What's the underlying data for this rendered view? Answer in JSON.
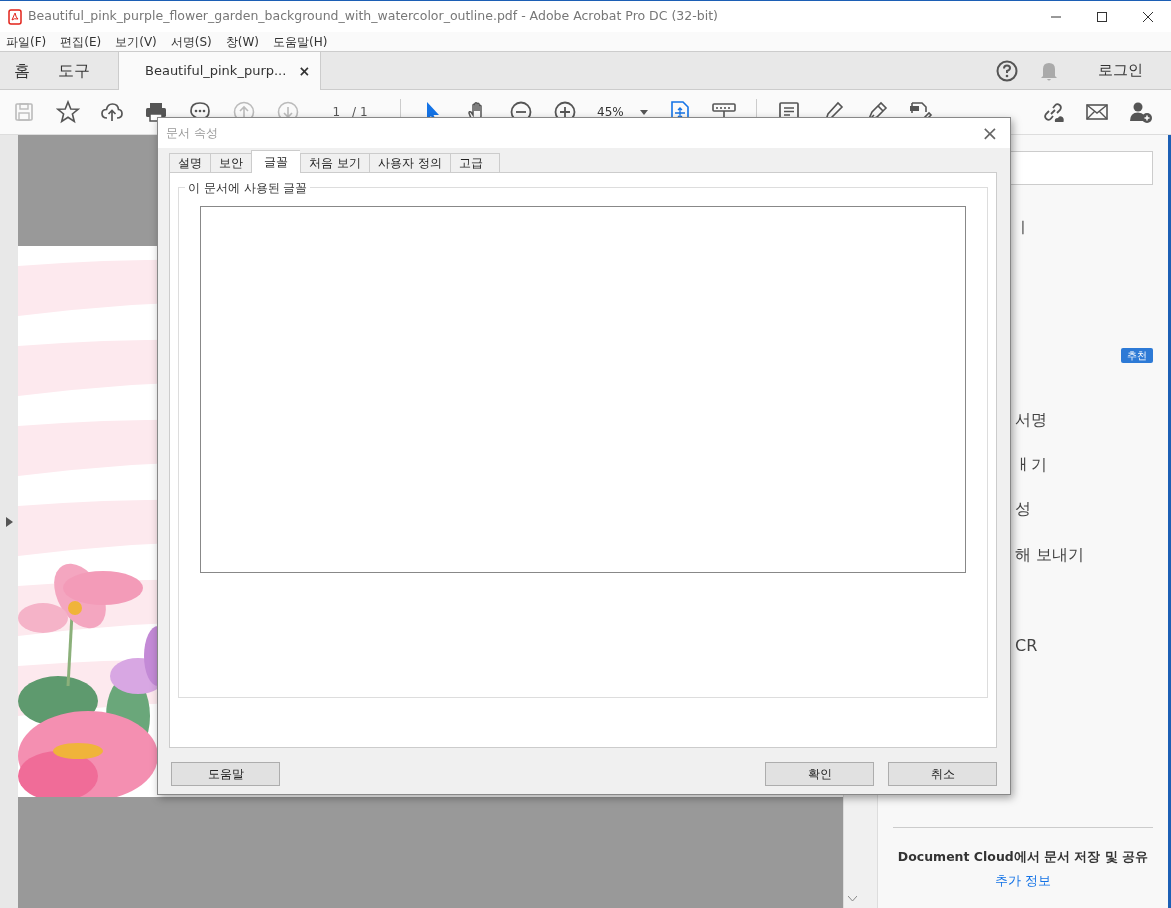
{
  "window": {
    "title": "Beautiful_pink_purple_flower_garden_background_with_watercolor_outline.pdf - Adobe Acrobat Pro DC (32-bit)"
  },
  "menu": [
    "파일(F)",
    "편집(E)",
    "보기(V)",
    "서명(S)",
    "창(W)",
    "도움말(H)"
  ],
  "app_tabs": [
    {
      "label": "홈",
      "selected": false
    },
    {
      "label": "도구",
      "selected": false
    },
    {
      "label": "Beautiful_pink_purp...",
      "selected": true,
      "close": "×"
    }
  ],
  "login": "로그인",
  "toolbar": {
    "items": [
      {
        "kind": "save",
        "disabled": true
      },
      {
        "kind": "star",
        "disabled": false
      },
      {
        "kind": "upload",
        "disabled": false
      },
      {
        "kind": "print",
        "disabled": false
      },
      {
        "kind": "more",
        "disabled": false
      },
      {
        "kind": "up",
        "disabled": true
      },
      {
        "kind": "down",
        "disabled": true
      }
    ],
    "page": "1",
    "page_total": "/ 1",
    "zoom": "45%",
    "tools": [
      {
        "kind": "select",
        "selected": true
      },
      {
        "kind": "hand",
        "selected": false
      },
      {
        "kind": "zoomout",
        "selected": false
      },
      {
        "kind": "zoomin",
        "selected": false
      }
    ],
    "tools2": [
      {
        "kind": "fit",
        "selected": true
      },
      {
        "kind": "ruler",
        "selected": false
      }
    ],
    "tools3": [
      {
        "kind": "comment"
      },
      {
        "kind": "highlight"
      },
      {
        "kind": "sign"
      },
      {
        "kind": "fillsign"
      }
    ],
    "share": [
      {
        "kind": "link"
      },
      {
        "kind": "mail"
      },
      {
        "kind": "adduser"
      }
    ]
  },
  "right_panel": {
    "items": [
      {
        "kind": "text",
        "text": "ㅣ"
      },
      {
        "kind": "badge",
        "text": "추천"
      },
      {
        "kind": "text",
        "text": "서명"
      },
      {
        "kind": "text",
        "text": "ㅐ기"
      },
      {
        "kind": "text",
        "text": "성"
      },
      {
        "kind": "text",
        "text": "해 보내기"
      },
      {
        "kind": "text",
        "text": "CR"
      }
    ],
    "footer_title": "Document Cloud에서 문서 저장 및 공유",
    "footer_link": "추가 정보"
  },
  "dialog": {
    "title": "문서 속성",
    "close": "×",
    "tabs": [
      {
        "label": "설명",
        "selected": false
      },
      {
        "label": "보안",
        "selected": false
      },
      {
        "label": "글꼴",
        "selected": true
      },
      {
        "label": "처음 보기",
        "selected": false
      },
      {
        "label": "사용자 정의",
        "selected": false
      },
      {
        "label": "고급",
        "selected": false
      }
    ],
    "group_label": "이 문서에 사용된 글꼴",
    "buttons": [
      {
        "label": "도움말",
        "kind": "help"
      },
      {
        "label": "확인",
        "kind": "ok"
      },
      {
        "label": "취소",
        "kind": "cancel"
      }
    ]
  }
}
